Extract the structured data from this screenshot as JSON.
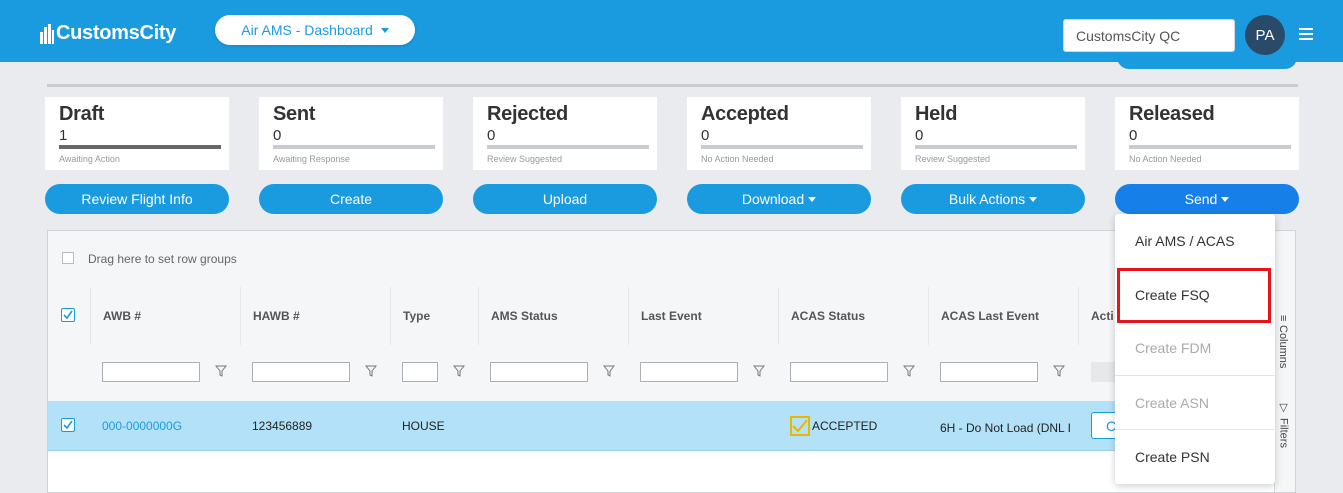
{
  "app": {
    "logo_text": "CustomsCity",
    "module_dropdown": "Air AMS - Dashboard",
    "org_field": "CustomsCity QC",
    "avatar_initials": "PA",
    "brand_color": "#1a9be0"
  },
  "status_cards": [
    {
      "title": "Draft",
      "count": "1",
      "subtitle": "Awaiting Action"
    },
    {
      "title": "Sent",
      "count": "0",
      "subtitle": "Awaiting Response"
    },
    {
      "title": "Rejected",
      "count": "0",
      "subtitle": "Review Suggested"
    },
    {
      "title": "Accepted",
      "count": "0",
      "subtitle": "No Action Needed"
    },
    {
      "title": "Held",
      "count": "0",
      "subtitle": "Review Suggested"
    },
    {
      "title": "Released",
      "count": "0",
      "subtitle": "No Action Needed"
    }
  ],
  "actions": [
    {
      "label": "Review Flight Info",
      "has_caret": false
    },
    {
      "label": "Create",
      "has_caret": false
    },
    {
      "label": "Upload",
      "has_caret": false
    },
    {
      "label": "Download",
      "has_caret": true
    },
    {
      "label": "Bulk Actions",
      "has_caret": true
    },
    {
      "label": "Send",
      "has_caret": true
    }
  ],
  "grid": {
    "group_panel_text": "Drag here to set row groups",
    "columns": [
      "AWB #",
      "HAWB #",
      "Type",
      "AMS Status",
      "Last Event",
      "ACAS Status",
      "ACAS Last Event",
      "Acti"
    ],
    "side_tabs": {
      "columns": "Columns",
      "filters": "Filters"
    },
    "rows": [
      {
        "selected": true,
        "awb": "000-0000000G",
        "hawb": "123456889",
        "type": "HOUSE",
        "ams_status": "",
        "last_event": "",
        "acas_status": "ACCEPTED",
        "acas_last_event": "6H - Do Not Load (DNL I",
        "action": "C"
      }
    ]
  },
  "send_menu": {
    "items": [
      {
        "label": "Air AMS / ACAS",
        "enabled": true
      },
      {
        "label": "Create FSQ",
        "enabled": true,
        "highlighted": true
      },
      {
        "label": "Create FDM",
        "enabled": false
      },
      {
        "label": "Create ASN",
        "enabled": false
      },
      {
        "label": "Create PSN",
        "enabled": true
      }
    ]
  }
}
